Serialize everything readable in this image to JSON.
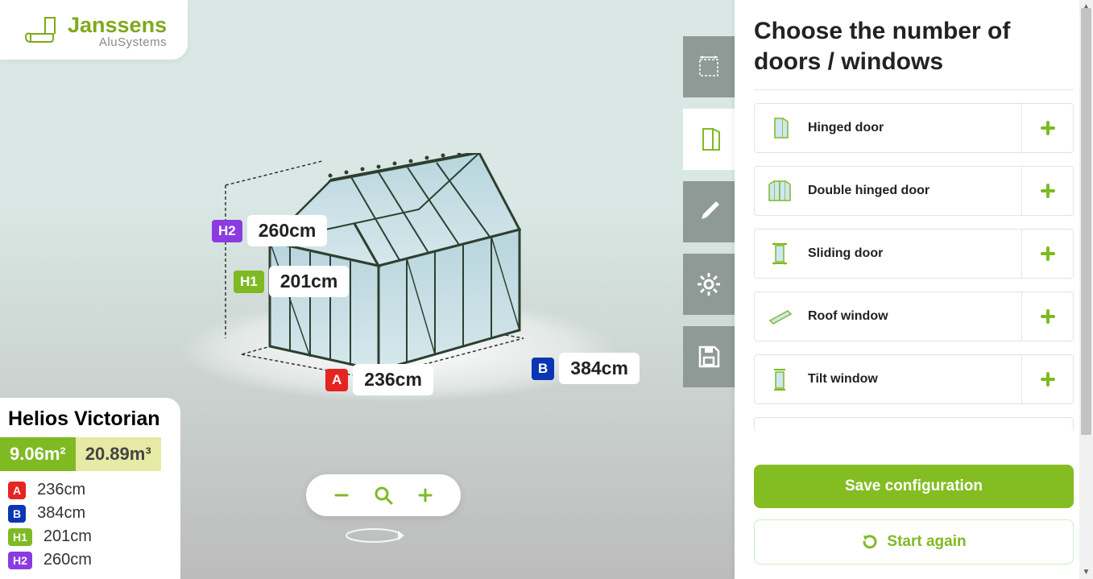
{
  "brand": {
    "name": "Janssens",
    "sub": "AluSystems"
  },
  "colors": {
    "accent": "#7fba23",
    "accent_dark": "#84bd22",
    "badge_red": "#e52521",
    "badge_blue": "#0a36b5",
    "badge_green": "#7fba23",
    "badge_purple": "#8a3ce0"
  },
  "model": {
    "name": "Helios Victorian",
    "area": "9.06m²",
    "volume": "20.89m³",
    "dims": {
      "A": {
        "label": "A",
        "value": "236cm",
        "color": "red"
      },
      "B": {
        "label": "B",
        "value": "384cm",
        "color": "blue"
      },
      "H1": {
        "label": "H1",
        "value": "201cm",
        "color": "green"
      },
      "H2": {
        "label": "H2",
        "value": "260cm",
        "color": "purple"
      }
    }
  },
  "viewport_labels": {
    "H2": {
      "label": "H2",
      "value": "260cm"
    },
    "H1": {
      "label": "H1",
      "value": "201cm"
    },
    "A": {
      "label": "A",
      "value": "236cm"
    },
    "B": {
      "label": "B",
      "value": "384cm"
    }
  },
  "rail": [
    {
      "id": "dimensions",
      "icon": "dimensions-icon",
      "active": false
    },
    {
      "id": "doors",
      "icon": "door-icon",
      "active": true
    },
    {
      "id": "paint",
      "icon": "paint-brush-icon",
      "active": false
    },
    {
      "id": "settings",
      "icon": "gear-icon",
      "active": false
    },
    {
      "id": "save",
      "icon": "save-disk-icon",
      "active": false
    }
  ],
  "panel": {
    "title": "Choose the number of doors / windows",
    "options": [
      {
        "id": "hinged-door",
        "label": "Hinged door",
        "icon": "hinged-door-icon"
      },
      {
        "id": "double-hinged-door",
        "label": "Double hinged door",
        "icon": "double-hinged-door-icon"
      },
      {
        "id": "sliding-door",
        "label": "Sliding door",
        "icon": "sliding-door-icon"
      },
      {
        "id": "roof-window",
        "label": "Roof window",
        "icon": "roof-window-icon"
      },
      {
        "id": "tilt-window",
        "label": "Tilt window",
        "icon": "tilt-window-icon"
      }
    ],
    "actions": {
      "save": "Save configuration",
      "restart": "Start again"
    }
  }
}
